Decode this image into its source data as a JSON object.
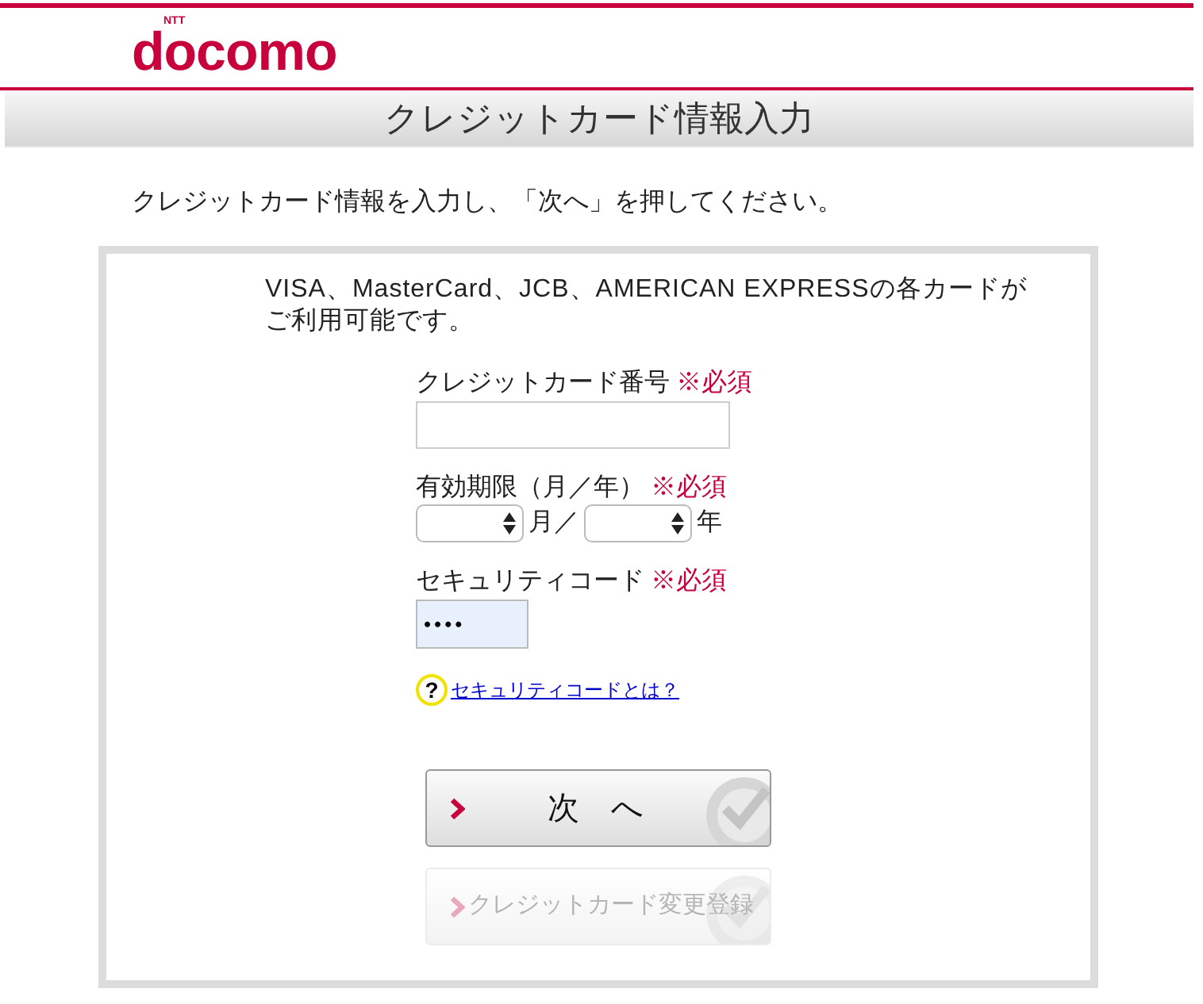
{
  "header": {
    "logo": {
      "small": "NTT",
      "name": "docomo"
    }
  },
  "page_title": "クレジットカード情報入力",
  "instruction": "クレジットカード情報を入力し、「次へ」を押してください。",
  "form": {
    "notice": "VISA、MasterCard、JCB、AMERICAN EXPRESSの各カードがご利用可能です。",
    "fields": [
      {
        "kind": "text",
        "label": "クレジットカード番号",
        "required": "※必須"
      },
      {
        "kind": "expiry",
        "label": "有効期限（月／年）",
        "required": "※必須",
        "selects": [
          {
            "unit": "月／"
          },
          {
            "unit": "年"
          }
        ]
      },
      {
        "kind": "password",
        "label": "セキュリティコード",
        "required": "※必須",
        "value": "••••"
      }
    ],
    "help": {
      "icon": "?",
      "link": "セキュリティコードとは？"
    },
    "buttons": [
      {
        "label": "次　へ",
        "disabled": false
      },
      {
        "label": "クレジットカード変更登録",
        "disabled": true
      }
    ]
  }
}
